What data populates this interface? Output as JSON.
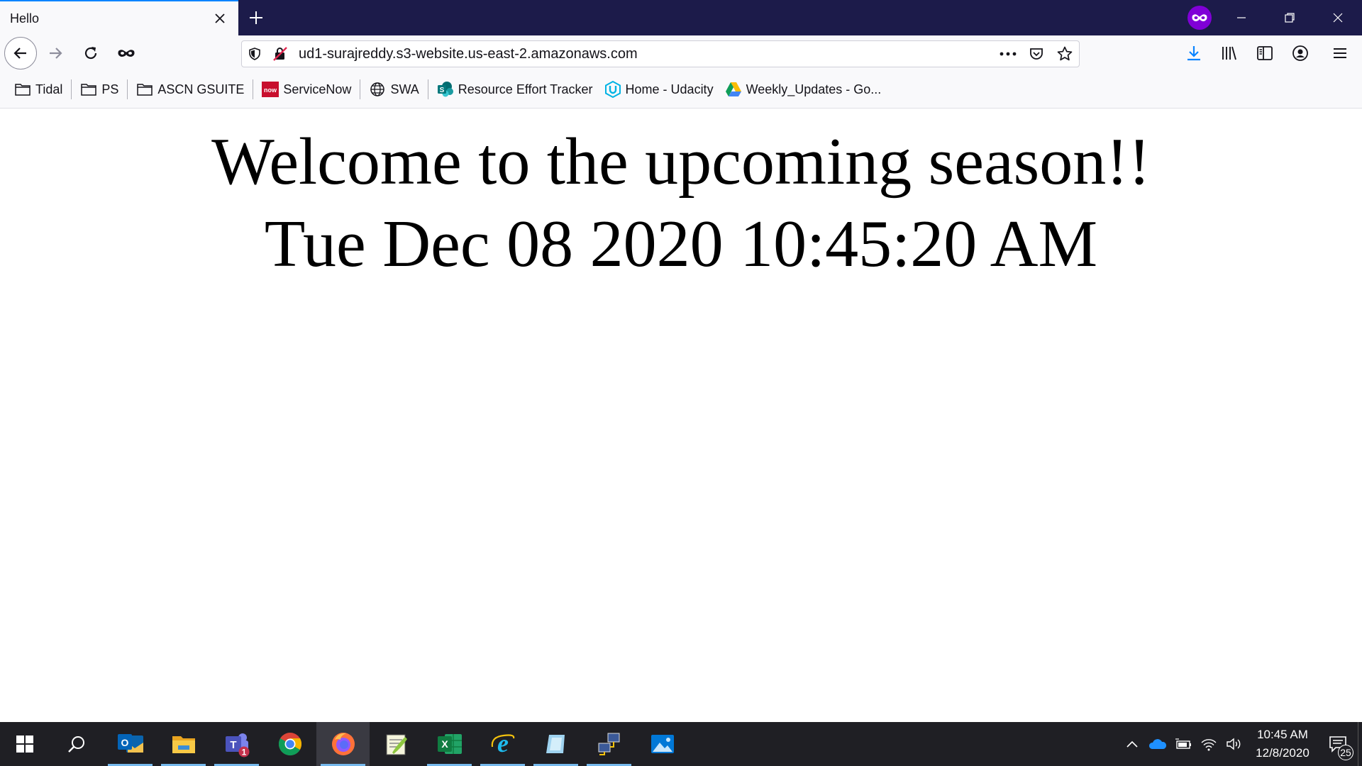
{
  "browser": {
    "tab": {
      "title": "Hello"
    },
    "url": "ud1-surajreddy.s3-website.us-east-2.amazonaws.com"
  },
  "bookmarks": [
    {
      "label": "Tidal",
      "icon": "folder-icon"
    },
    {
      "label": "PS",
      "icon": "folder-icon"
    },
    {
      "label": "ASCN GSUITE",
      "icon": "folder-icon"
    },
    {
      "label": "ServiceNow",
      "icon": "servicenow-icon"
    },
    {
      "label": "SWA",
      "icon": "globe-icon"
    },
    {
      "label": "Resource Effort Tracker",
      "icon": "sharepoint-icon"
    },
    {
      "label": "Home - Udacity",
      "icon": "udacity-icon"
    },
    {
      "label": "Weekly_Updates - Go...",
      "icon": "google-drive-icon"
    }
  ],
  "page": {
    "headline": "Welcome to the upcoming season!!",
    "datetime": "Tue Dec 08 2020 10:45:20 AM"
  },
  "taskbar": {
    "apps": [
      "outlook",
      "file-explorer",
      "teams",
      "chrome",
      "firefox",
      "notepad-plus",
      "excel",
      "internet-explorer",
      "app-blue",
      "network-app",
      "photos"
    ],
    "teams_badge": "1",
    "clock": {
      "time": "10:45 AM",
      "date": "12/8/2020"
    },
    "notification_count": "25"
  },
  "colors": {
    "tabbar": "#1c1b4a",
    "accent": "#0a84ff",
    "private": "#8000d7",
    "taskbar": "#1f1f24"
  }
}
